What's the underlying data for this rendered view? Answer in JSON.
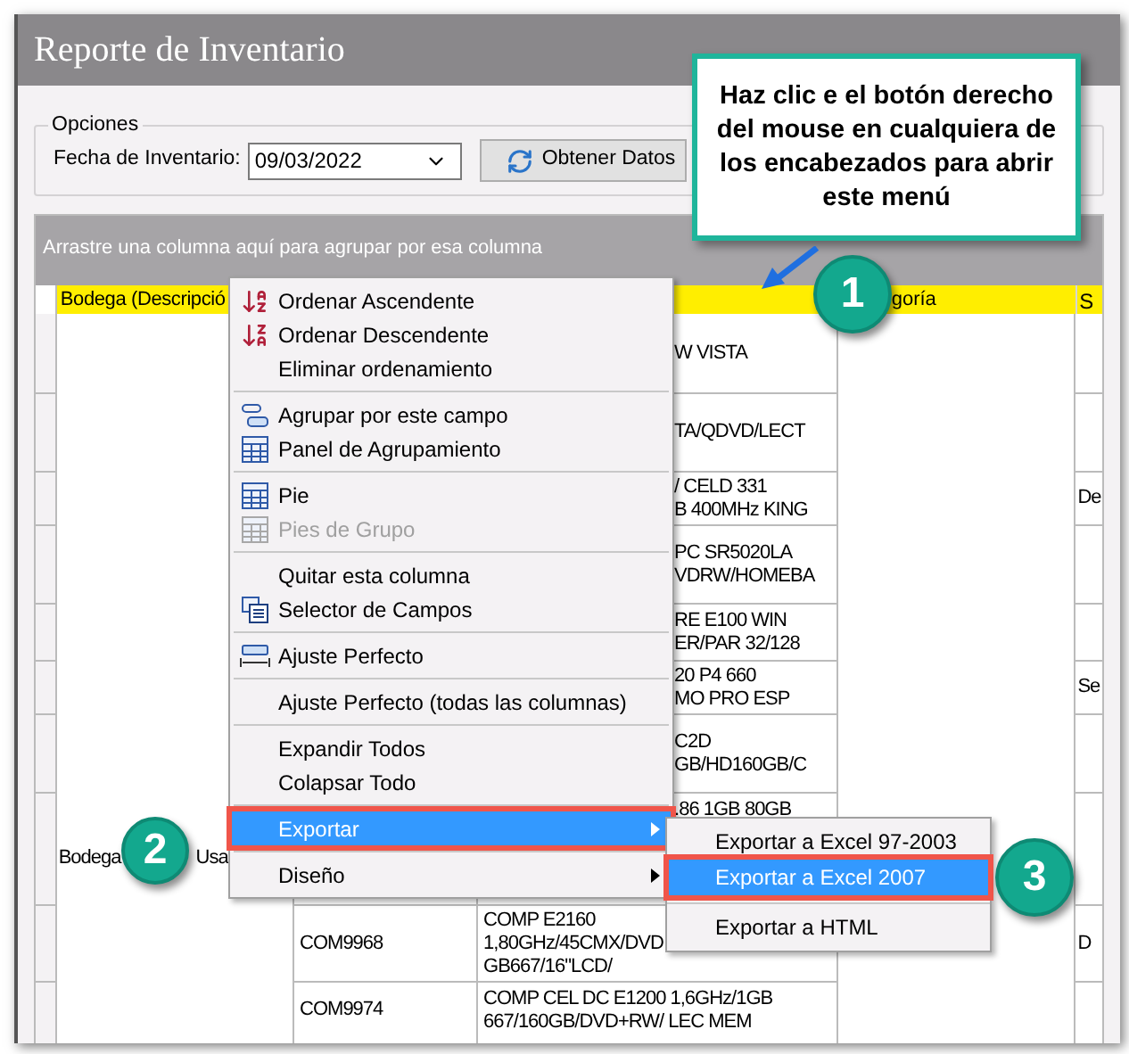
{
  "window": {
    "title": "Reporte de Inventario"
  },
  "options": {
    "group_label": "Opciones",
    "date_label": "Fecha de Inventario:",
    "date_value": "09/03/2022",
    "fetch_button": "Obtener Datos"
  },
  "grid": {
    "group_hint": "Arrastre una columna aquí para agrupar por esa columna",
    "header": {
      "column_1": "Bodega (Descripció",
      "column_4": "goría",
      "column_5": "S"
    },
    "group_cell": [
      "Bodega",
      "Usa"
    ],
    "rows": [
      {
        "description": [
          "W VISTA"
        ]
      },
      {
        "description": [
          "TA/QDVD/LECT"
        ]
      },
      {
        "description": [
          "/ CELD 331",
          "B 400MHz KING"
        ],
        "column_5": "De"
      },
      {
        "description": [
          "PC SR5020LA",
          "VDRW/HOMEBA"
        ]
      },
      {
        "description": [
          "RE E100 WIN",
          "ER/PAR 32/128"
        ]
      },
      {
        "description": [
          "20 P4 660",
          "MO PRO ESP"
        ],
        "column_5": "Se"
      },
      {
        "description": [
          "C2D",
          "GB/HD160GB/C"
        ]
      },
      {
        "description": [
          ".86 1GB 80GB"
        ]
      },
      {
        "code": "COM9968",
        "description": [
          "COMP E2160",
          "1,80GHz/45CMX/DVD",
          "GB667/16\"LCD/"
        ],
        "column_5": "D"
      },
      {
        "code": "COM9974",
        "description": [
          "COMP CEL DC E1200 1,6GHz/1GB",
          "667/160GB/DVD+RW/ LEC MEM"
        ]
      }
    ]
  },
  "context_menu": {
    "items": [
      {
        "kind": "item",
        "label": "Ordenar Ascendente",
        "disabled": false,
        "selected": false,
        "submenu": false
      },
      {
        "kind": "item",
        "label": "Ordenar Descendente",
        "disabled": false,
        "selected": false,
        "submenu": false
      },
      {
        "kind": "item",
        "label": "Eliminar ordenamiento",
        "disabled": false,
        "selected": false,
        "submenu": false
      },
      {
        "kind": "separator"
      },
      {
        "kind": "item",
        "label": "Agrupar por este campo",
        "disabled": false,
        "selected": false,
        "submenu": false
      },
      {
        "kind": "item",
        "label": "Panel de Agrupamiento",
        "disabled": false,
        "selected": false,
        "submenu": false
      },
      {
        "kind": "separator"
      },
      {
        "kind": "item",
        "label": "Pie",
        "disabled": false,
        "selected": false,
        "submenu": false
      },
      {
        "kind": "item",
        "label": "Pies de Grupo",
        "disabled": true,
        "selected": false,
        "submenu": false
      },
      {
        "kind": "separator"
      },
      {
        "kind": "item",
        "label": "Quitar esta columna",
        "disabled": false,
        "selected": false,
        "submenu": false
      },
      {
        "kind": "item",
        "label": "Selector de Campos",
        "disabled": false,
        "selected": false,
        "submenu": false
      },
      {
        "kind": "separator"
      },
      {
        "kind": "item",
        "label": "Ajuste Perfecto",
        "disabled": false,
        "selected": false,
        "submenu": false
      },
      {
        "kind": "separator"
      },
      {
        "kind": "item",
        "label": "Ajuste Perfecto (todas las columnas)",
        "disabled": false,
        "selected": false,
        "submenu": false
      },
      {
        "kind": "separator"
      },
      {
        "kind": "item",
        "label": "Expandir Todos",
        "disabled": false,
        "selected": false,
        "submenu": false
      },
      {
        "kind": "item",
        "label": "Colapsar Todo",
        "disabled": false,
        "selected": false,
        "submenu": false
      },
      {
        "kind": "separator"
      },
      {
        "kind": "item",
        "label": "Exportar",
        "disabled": false,
        "selected": true,
        "submenu": true
      },
      {
        "kind": "separator"
      },
      {
        "kind": "item",
        "label": "Diseño",
        "disabled": false,
        "selected": false,
        "submenu": true
      }
    ]
  },
  "export_submenu": {
    "items": [
      {
        "kind": "item",
        "label": "Exportar a Excel 97-2003",
        "selected": false
      },
      {
        "kind": "item",
        "label": "Exportar a Excel 2007",
        "selected": true
      },
      {
        "kind": "separator"
      },
      {
        "kind": "item",
        "label": "Exportar a HTML",
        "selected": false
      }
    ]
  },
  "callout": {
    "note": "Haz clic e el botón derecho del mouse en cualquiera de los encabezados para abrir este menú",
    "steps": [
      "1",
      "2",
      "3"
    ]
  }
}
